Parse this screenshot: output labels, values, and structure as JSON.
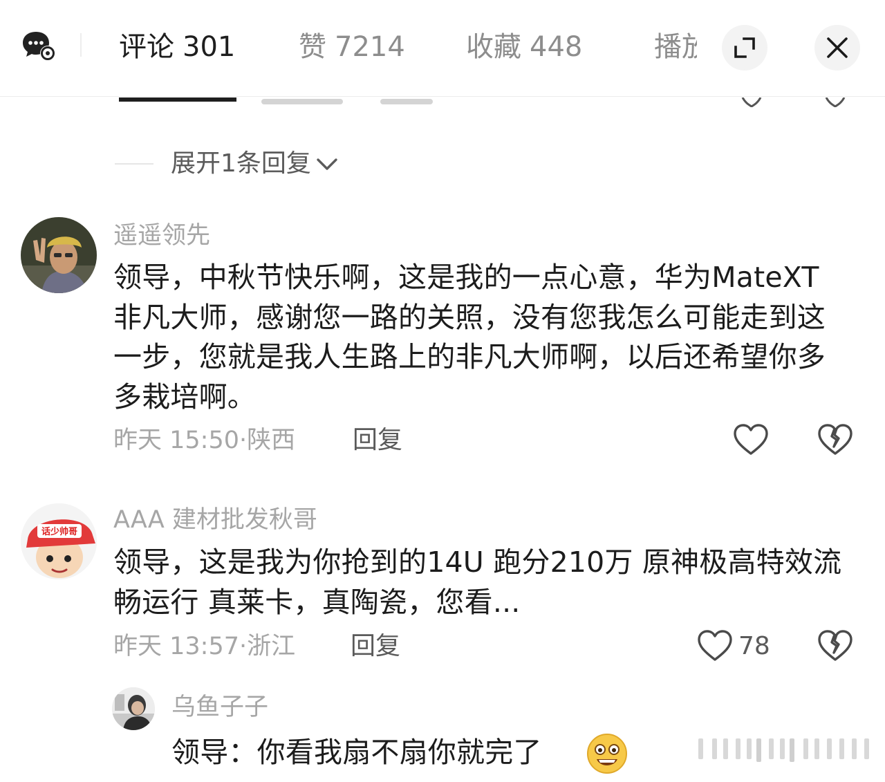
{
  "header": {
    "tabs": [
      {
        "label": "评论",
        "count": "301",
        "active": true
      },
      {
        "label": "赞",
        "count": "7214",
        "active": false
      },
      {
        "label": "收藏",
        "count": "448",
        "active": false
      },
      {
        "label": "播放",
        "count": "",
        "active": false
      }
    ],
    "mode_icon": "comment-mode-icon",
    "fullscreen_icon": "expand-icon",
    "close_icon": "close-icon"
  },
  "thread": {
    "expand_label": "展开1条回复"
  },
  "comments": [
    {
      "username": "遥遥领先",
      "text": "领导，中秋节快乐啊，这是我的一点心意，华为MateXT非凡大师，感谢您一路的关照，没有您我怎么可能走到这一步，您就是我人生路上的非凡大师啊，以后还希望你多多栽培啊。",
      "time": "昨天 15:50",
      "location": "陕西",
      "reply_label": "回复",
      "likes": ""
    },
    {
      "username": "AAA 建材批发秋哥",
      "avatar_text": "话少帅哥",
      "text": "领导，这是我为你抢到的14U 跑分210万 原神极高特效流畅运行 真莱卡，真陶瓷，您看...",
      "time": "昨天 13:57",
      "location": "浙江",
      "reply_label": "回复",
      "likes": "78"
    }
  ],
  "reply": {
    "username": "乌鱼子子",
    "text": "领导：你看我扇不扇你就完了",
    "emoji": "grinning-face-emoji"
  },
  "colors": {
    "accent_text": "#1e1e1e",
    "muted_text": "#a6a6a6",
    "body_text": "#1c1c1c"
  }
}
